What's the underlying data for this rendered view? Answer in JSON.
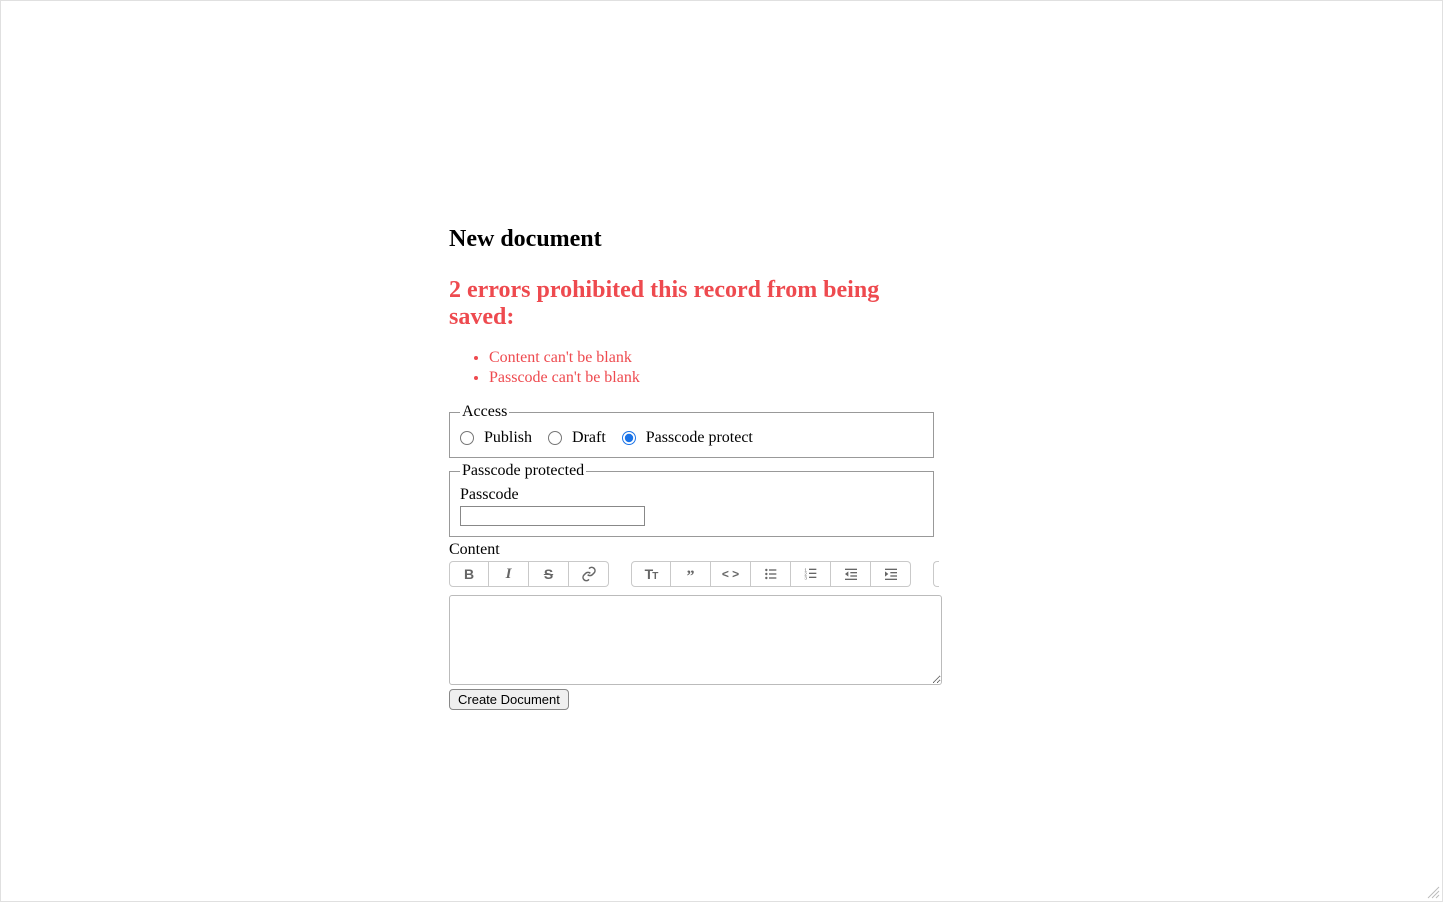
{
  "page": {
    "title": "New document"
  },
  "errors": {
    "heading": "2 errors prohibited this record from being saved:",
    "items": [
      "Content can't be blank",
      "Passcode can't be blank"
    ]
  },
  "access_fieldset": {
    "legend": "Access",
    "options": {
      "publish": {
        "label": "Publish",
        "checked": false
      },
      "draft": {
        "label": "Draft",
        "checked": false
      },
      "passcode_protect": {
        "label": "Passcode protect",
        "checked": true
      }
    }
  },
  "passcode_fieldset": {
    "legend": "Passcode protected",
    "label": "Passcode",
    "value": ""
  },
  "content": {
    "label": "Content",
    "value": ""
  },
  "toolbar": {
    "bold_title": "Bold",
    "italic_title": "Italic",
    "strike_title": "Strikethrough",
    "link_title": "Link",
    "heading_title": "Heading",
    "quote_title": "Quote",
    "code_title": "Code",
    "ul_title": "Bullet list",
    "ol_title": "Numbered list",
    "outdent_title": "Decrease indent",
    "indent_title": "Increase indent"
  },
  "submit": {
    "label": "Create Document"
  }
}
